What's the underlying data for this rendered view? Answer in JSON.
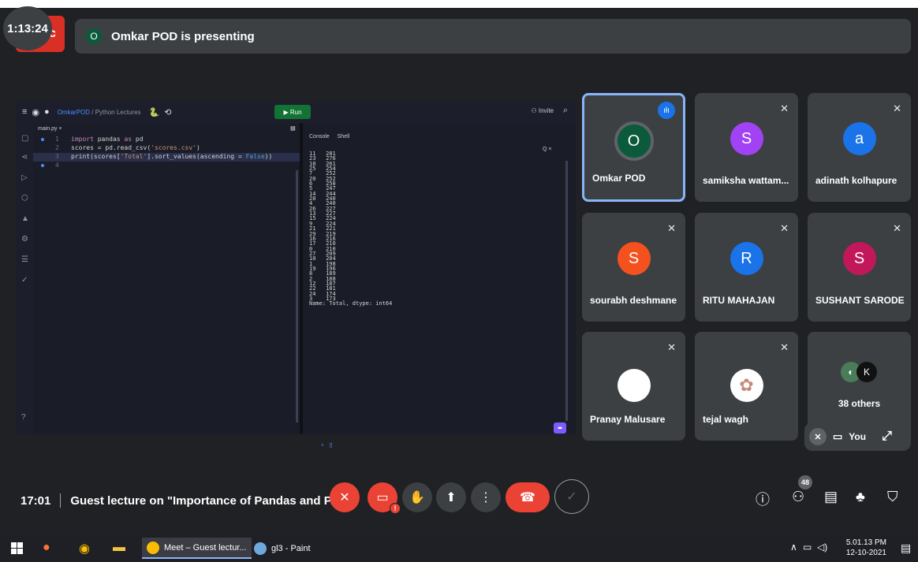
{
  "recording": {
    "timer": "1:13:24",
    "rec_label": "c"
  },
  "banner": {
    "avatar_letter": "O",
    "text": "Omkar POD is presenting"
  },
  "ide": {
    "breadcrumb_user": "OmkarPOD",
    "breadcrumb_project": " / Python Lectures",
    "run_label": "▶ Run",
    "invite_label": "Invite",
    "file_tab": "main.py ×",
    "console_tab": "Console",
    "shell_tab": "Shell",
    "console_search": "Q ×",
    "code": [
      {
        "ln": "1",
        "html": "<span class=\"kw2\">import</span> pandas <span class=\"kw2\">as</span> pd"
      },
      {
        "ln": "2",
        "html": "scores = pd.read_csv(<span class=\"str\">'scores.csv'</span>)"
      },
      {
        "ln": "3",
        "html": "print(scores[<span class=\"str\">'Total'</span>].sort_values(ascending = <span class=\"kw\">False</span>))"
      },
      {
        "ln": "4",
        "html": ""
      }
    ],
    "output": "11   281\n23   276\n18   261\n25   254\n7    252\n20   252\n6    250\n5    247\n14   244\n28   240\n4    240\n26   227\n13   227\n15   224\n9    224\n21   221\n29   219\n16   216\n17   210\n0    210\n27   209\n10   204\n1    198\n19   196\n8    189\n2    188\n12   187\n22   181\n24   174\n3    173\nName: Total, dtype: int64",
    "prompt": "› ▯"
  },
  "tiles": [
    {
      "name": "Omkar POD",
      "letter": "O",
      "color": "#0b5a3c"
    },
    {
      "name": "samiksha wattam...",
      "letter": "S",
      "color": "#a142f4"
    },
    {
      "name": "adinath kolhapure",
      "letter": "a",
      "color": "#1a73e8"
    },
    {
      "name": "sourabh deshmane",
      "letter": "S",
      "color": "#f4511e"
    },
    {
      "name": "RITU MAHAJAN",
      "letter": "R",
      "color": "#1a73e8"
    },
    {
      "name": "SUSHANT SARODE",
      "letter": "S",
      "color": "#c2185b"
    },
    {
      "name": "Pranay Malusare",
      "letter": "",
      "color": "#ffffff"
    },
    {
      "name": "tejal wagh",
      "letter": "",
      "color": "#ffffff"
    },
    {
      "name": "38 others",
      "letter": "",
      "color": "#3c4043"
    }
  ],
  "self_view": {
    "label": "You"
  },
  "controls": {
    "clock": "17:01",
    "meeting_title": "Guest lecture on \"Importance of Pandas and P...",
    "people_count": "48"
  },
  "taskbar": {
    "meet_app": "Meet – Guest lectur...",
    "paint_app": "gl3 - Paint",
    "time": "5.01.13 PM",
    "date": "12-10-2021"
  },
  "colors": {
    "meet_bg": "#202124",
    "tile_bg": "#3c4043",
    "red": "#ea4335",
    "active_border": "#8ab4f8"
  }
}
